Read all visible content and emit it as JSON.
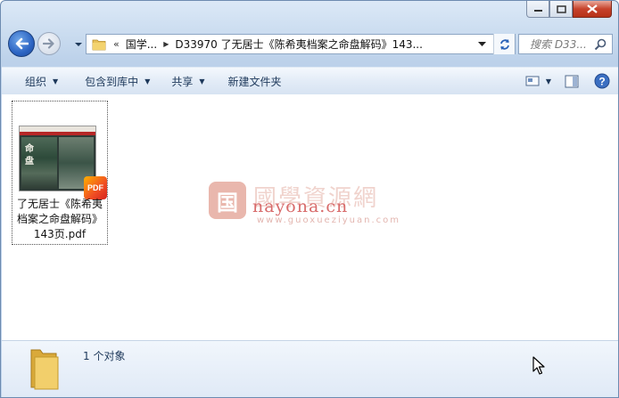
{
  "window": {
    "caption_buttons": [
      "minimize",
      "maximize",
      "close"
    ]
  },
  "address": {
    "overflow_chevron": "«",
    "crumbs": [
      "国学...",
      "D33970 了无居士《陈希夷档案之命盘解码》143..."
    ]
  },
  "search": {
    "placeholder": "搜索 D33..."
  },
  "toolbar": {
    "organize": "组织",
    "include_library": "包含到库中",
    "share": "共享",
    "new_folder": "新建文件夹"
  },
  "file": {
    "name": "了无居士《陈希夷档案之命盘解码》143页.pdf",
    "label_lines": [
      "了无居士《陈希夷",
      "档案之命盘解码》",
      "143页.pdf"
    ],
    "badge": "PDF",
    "thumb_glyphs": [
      "命",
      "盘"
    ]
  },
  "watermark": {
    "seal": "国",
    "title": "國學資源網",
    "url": "nayona.cn",
    "sub": "www.guoxueziyuan.com"
  },
  "status": {
    "count": "1 个对象"
  },
  "colors": {
    "accent": "#1e395b",
    "close": "#c7432c"
  }
}
